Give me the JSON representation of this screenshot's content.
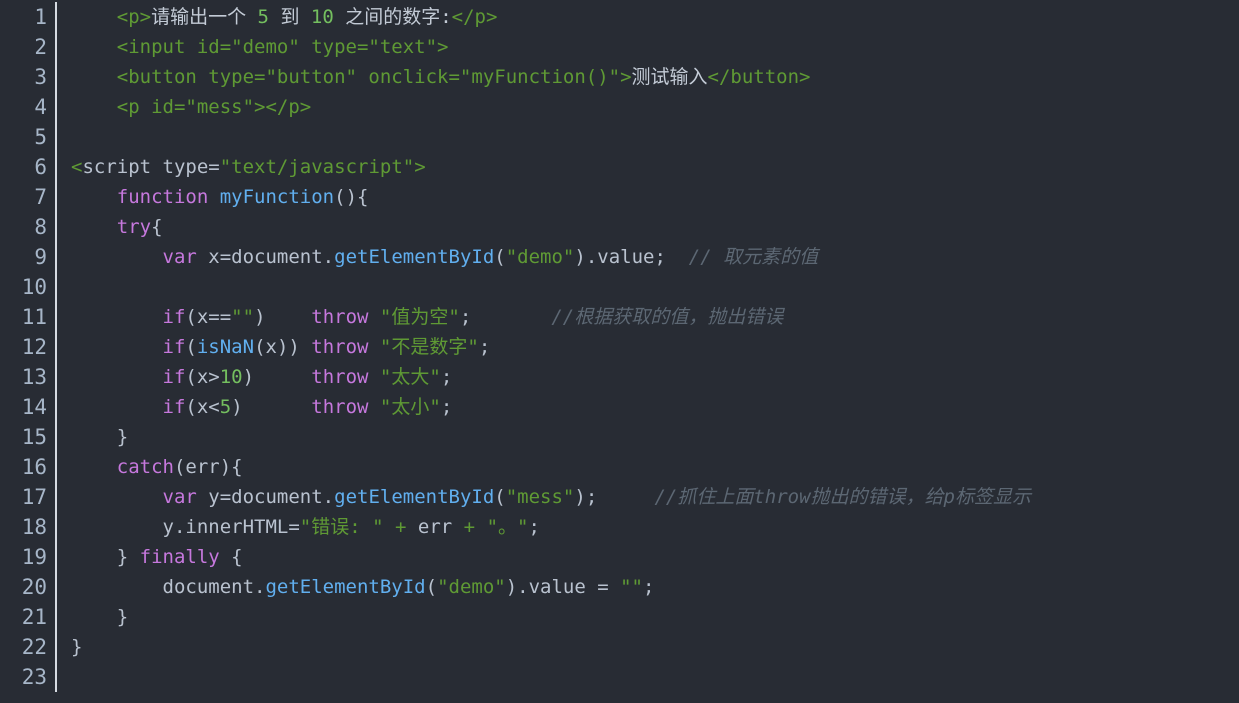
{
  "editor": {
    "name": "code-editor",
    "theme": "one-dark",
    "background_color": "#282c34",
    "gutter_color": "#a7b6c8",
    "separator_color": "#d6dbe2",
    "language": "html",
    "total_lines": 23,
    "colors": {
      "tag": "#5f9a34",
      "string": "#5f9a34",
      "number": "#74bf5f",
      "keyword": "#c678dd",
      "function": "#61afef",
      "comment": "#5c6773",
      "plain": "#b9c2cf",
      "text": "#c3cbd6"
    }
  },
  "line_numbers": [
    "1",
    "2",
    "3",
    "4",
    "5",
    "6",
    "7",
    "8",
    "9",
    "10",
    "11",
    "12",
    "13",
    "14",
    "15",
    "16",
    "17",
    "18",
    "19",
    "20",
    "21",
    "22",
    "23"
  ],
  "code_lines": [
    {
      "number": "1",
      "text": "    <p>请输出一个 5 到 10 之间的数字:</p>",
      "tokens": [
        {
          "t": "    ",
          "c": "t-plain"
        },
        {
          "t": "<p>",
          "c": "t-tag"
        },
        {
          "t": "请输出一个 ",
          "c": "t-text"
        },
        {
          "t": "5",
          "c": "t-num"
        },
        {
          "t": " 到 ",
          "c": "t-text"
        },
        {
          "t": "10",
          "c": "t-num"
        },
        {
          "t": " 之间的数字:",
          "c": "t-text"
        },
        {
          "t": "</p>",
          "c": "t-tag"
        }
      ]
    },
    {
      "number": "2",
      "text": "    <input id=\"demo\" type=\"text\">",
      "tokens": [
        {
          "t": "    ",
          "c": "t-plain"
        },
        {
          "t": "<input id=\"demo\" type=\"text\">",
          "c": "t-tag"
        }
      ]
    },
    {
      "number": "3",
      "text": "    <button type=\"button\" onclick=\"myFunction()\">测试输入</button>",
      "tokens": [
        {
          "t": "    ",
          "c": "t-plain"
        },
        {
          "t": "<button type=\"button\" onclick=\"myFunction()\">",
          "c": "t-tag"
        },
        {
          "t": "测试输入",
          "c": "t-text"
        },
        {
          "t": "</button>",
          "c": "t-tag"
        }
      ]
    },
    {
      "number": "4",
      "text": "    <p id=\"mess\"></p>",
      "tokens": [
        {
          "t": "    ",
          "c": "t-plain"
        },
        {
          "t": "<p id=\"mess\"></p>",
          "c": "t-tag"
        }
      ]
    },
    {
      "number": "5",
      "text": "",
      "tokens": []
    },
    {
      "number": "6",
      "text": "<script type=\"text/javascript\">",
      "tokens": [
        {
          "t": "<",
          "c": "t-tag"
        },
        {
          "t": "script",
          "c": "t-plain"
        },
        {
          "t": " type=",
          "c": "t-plain"
        },
        {
          "t": "\"text/javascript\"",
          "c": "t-green"
        },
        {
          "t": ">",
          "c": "t-tag"
        }
      ]
    },
    {
      "number": "7",
      "text": "    function myFunction(){",
      "tokens": [
        {
          "t": "    ",
          "c": "t-plain"
        },
        {
          "t": "function",
          "c": "t-kw"
        },
        {
          "t": " ",
          "c": "t-plain"
        },
        {
          "t": "myFunction",
          "c": "t-fn"
        },
        {
          "t": "(){",
          "c": "t-plain"
        }
      ]
    },
    {
      "number": "8",
      "text": "    try{",
      "tokens": [
        {
          "t": "    ",
          "c": "t-plain"
        },
        {
          "t": "try",
          "c": "t-kw"
        },
        {
          "t": "{",
          "c": "t-plain"
        }
      ]
    },
    {
      "number": "9",
      "text": "        var x=document.getElementById(\"demo\").value;  // 取元素的值",
      "tokens": [
        {
          "t": "        ",
          "c": "t-plain"
        },
        {
          "t": "var",
          "c": "t-kw"
        },
        {
          "t": " x=document.",
          "c": "t-plain"
        },
        {
          "t": "getElementById",
          "c": "t-fn"
        },
        {
          "t": "(",
          "c": "t-plain"
        },
        {
          "t": "\"demo\"",
          "c": "t-green"
        },
        {
          "t": ").value;  ",
          "c": "t-plain"
        },
        {
          "t": "// 取元素的值",
          "c": "t-com"
        }
      ]
    },
    {
      "number": "10",
      "text": "",
      "tokens": []
    },
    {
      "number": "11",
      "text": "        if(x==\"\")    throw \"值为空\";       //根据获取的值，抛出错误",
      "tokens": [
        {
          "t": "        ",
          "c": "t-plain"
        },
        {
          "t": "if",
          "c": "t-kw"
        },
        {
          "t": "(x==",
          "c": "t-plain"
        },
        {
          "t": "\"\"",
          "c": "t-green"
        },
        {
          "t": ")    ",
          "c": "t-plain"
        },
        {
          "t": "throw",
          "c": "t-kw"
        },
        {
          "t": " ",
          "c": "t-plain"
        },
        {
          "t": "\"值为空\"",
          "c": "t-green"
        },
        {
          "t": ";       ",
          "c": "t-plain"
        },
        {
          "t": "//根据获取的值，抛出错误",
          "c": "t-com"
        }
      ]
    },
    {
      "number": "12",
      "text": "        if(isNaN(x)) throw \"不是数字\";",
      "tokens": [
        {
          "t": "        ",
          "c": "t-plain"
        },
        {
          "t": "if",
          "c": "t-kw"
        },
        {
          "t": "(",
          "c": "t-plain"
        },
        {
          "t": "isNaN",
          "c": "t-fn"
        },
        {
          "t": "(x)) ",
          "c": "t-plain"
        },
        {
          "t": "throw",
          "c": "t-kw"
        },
        {
          "t": " ",
          "c": "t-plain"
        },
        {
          "t": "\"不是数字\"",
          "c": "t-green"
        },
        {
          "t": ";",
          "c": "t-plain"
        }
      ]
    },
    {
      "number": "13",
      "text": "        if(x>10)     throw \"太大\";",
      "tokens": [
        {
          "t": "        ",
          "c": "t-plain"
        },
        {
          "t": "if",
          "c": "t-kw"
        },
        {
          "t": "(x>",
          "c": "t-plain"
        },
        {
          "t": "10",
          "c": "t-num"
        },
        {
          "t": ")     ",
          "c": "t-plain"
        },
        {
          "t": "throw",
          "c": "t-kw"
        },
        {
          "t": " ",
          "c": "t-plain"
        },
        {
          "t": "\"太大\"",
          "c": "t-green"
        },
        {
          "t": ";",
          "c": "t-plain"
        }
      ]
    },
    {
      "number": "14",
      "text": "        if(x<5)      throw \"太小\";",
      "tokens": [
        {
          "t": "        ",
          "c": "t-plain"
        },
        {
          "t": "if",
          "c": "t-kw"
        },
        {
          "t": "(x<",
          "c": "t-plain"
        },
        {
          "t": "5",
          "c": "t-num"
        },
        {
          "t": ")      ",
          "c": "t-plain"
        },
        {
          "t": "throw",
          "c": "t-kw"
        },
        {
          "t": " ",
          "c": "t-plain"
        },
        {
          "t": "\"太小\"",
          "c": "t-green"
        },
        {
          "t": ";",
          "c": "t-plain"
        }
      ]
    },
    {
      "number": "15",
      "text": "    }",
      "tokens": [
        {
          "t": "    }",
          "c": "t-plain"
        }
      ]
    },
    {
      "number": "16",
      "text": "    catch(err){",
      "tokens": [
        {
          "t": "    ",
          "c": "t-plain"
        },
        {
          "t": "catch",
          "c": "t-kw"
        },
        {
          "t": "(err){",
          "c": "t-plain"
        }
      ]
    },
    {
      "number": "17",
      "text": "        var y=document.getElementById(\"mess\");     //抓住上面throw抛出的错误，给p标签显示",
      "tokens": [
        {
          "t": "        ",
          "c": "t-plain"
        },
        {
          "t": "var",
          "c": "t-kw"
        },
        {
          "t": " y=document.",
          "c": "t-plain"
        },
        {
          "t": "getElementById",
          "c": "t-fn"
        },
        {
          "t": "(",
          "c": "t-plain"
        },
        {
          "t": "\"mess\"",
          "c": "t-green"
        },
        {
          "t": ");     ",
          "c": "t-plain"
        },
        {
          "t": "//抓住上面throw抛出的错误，给p标签显示",
          "c": "t-com"
        }
      ]
    },
    {
      "number": "18",
      "text": "        y.innerHTML=\"错误: \" + err + \"。\";",
      "tokens": [
        {
          "t": "        ",
          "c": "t-plain"
        },
        {
          "t": "y.innerHTML=",
          "c": "t-plain"
        },
        {
          "t": "\"错误: \"",
          "c": "t-green"
        },
        {
          "t": " ",
          "c": "t-plain"
        },
        {
          "t": "+",
          "c": "t-green"
        },
        {
          "t": " err ",
          "c": "t-plain"
        },
        {
          "t": "+",
          "c": "t-green"
        },
        {
          "t": " ",
          "c": "t-plain"
        },
        {
          "t": "\"。\"",
          "c": "t-green"
        },
        {
          "t": ";",
          "c": "t-plain"
        }
      ]
    },
    {
      "number": "19",
      "text": "    } finally {",
      "tokens": [
        {
          "t": "    } ",
          "c": "t-plain"
        },
        {
          "t": "finally",
          "c": "t-kw"
        },
        {
          "t": " {",
          "c": "t-plain"
        }
      ]
    },
    {
      "number": "20",
      "text": "        document.getElementById(\"demo\").value = \"\";",
      "tokens": [
        {
          "t": "        document.",
          "c": "t-plain"
        },
        {
          "t": "getElementById",
          "c": "t-fn"
        },
        {
          "t": "(",
          "c": "t-plain"
        },
        {
          "t": "\"demo\"",
          "c": "t-green"
        },
        {
          "t": ").value = ",
          "c": "t-plain"
        },
        {
          "t": "\"\"",
          "c": "t-green"
        },
        {
          "t": ";",
          "c": "t-plain"
        }
      ]
    },
    {
      "number": "21",
      "text": "    }",
      "tokens": [
        {
          "t": "    }",
          "c": "t-plain"
        }
      ]
    },
    {
      "number": "22",
      "text": "}",
      "tokens": [
        {
          "t": "}",
          "c": "t-plain"
        }
      ]
    },
    {
      "number": "23",
      "text": "",
      "tokens": []
    }
  ]
}
